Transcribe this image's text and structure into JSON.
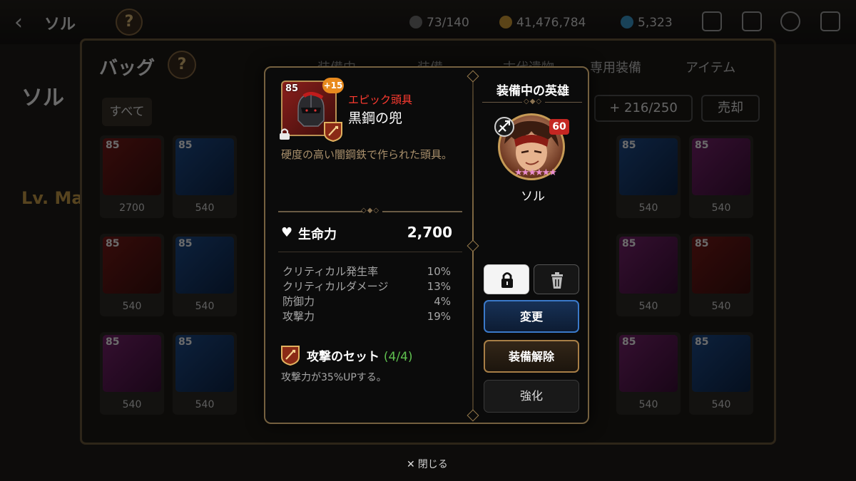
{
  "topbar": {
    "back_label": "‹",
    "title": "ソル",
    "help_label": "?",
    "stamina": "73/140",
    "gold": "41,476,784",
    "crystals": "5,323"
  },
  "bag": {
    "title": "バッグ",
    "help_label": "?",
    "tabs": [
      "装備中",
      "装備",
      "古代遺物",
      "専用装備",
      "アイテム"
    ],
    "filter_all": "すべて",
    "slot_count": "+ 216/250",
    "sell_label": "売却",
    "side_hero": "ソル",
    "side_level": "Lv. Ma",
    "grid": [
      {
        "lvl": "85",
        "val": "2700",
        "color": "red"
      },
      {
        "lvl": "85",
        "val": "540",
        "color": "blue"
      },
      {
        "lvl": "85",
        "val": "540",
        "color": "red"
      },
      {
        "lvl": "85",
        "val": "540",
        "color": "blue"
      },
      {
        "lvl": "85",
        "val": "540",
        "color": "purple"
      },
      {
        "lvl": "85",
        "val": "540",
        "color": "purple"
      },
      {
        "lvl": "85",
        "val": "540",
        "color": "purple"
      },
      {
        "lvl": "85",
        "val": "540",
        "color": "blue"
      },
      {
        "lvl": "85",
        "val": "540",
        "color": "purple"
      },
      {
        "lvl": "85",
        "val": "540",
        "color": "purple"
      },
      {
        "lvl": "85",
        "val": "540",
        "color": "purple"
      },
      {
        "lvl": "85",
        "val": "540",
        "color": "blue"
      }
    ]
  },
  "close_label": "閉じる",
  "item": {
    "level": "85",
    "enhance": "+15",
    "grade": "エピック頭具",
    "name": "黒鋼の兜",
    "description": "硬度の高い闇鋼鉄で作られた頭具。",
    "main_stat": {
      "label": "生命力",
      "value": "2,700"
    },
    "sub_stats": [
      {
        "label": "クリティカル発生率",
        "value": "10%"
      },
      {
        "label": "クリティカルダメージ",
        "value": "13%"
      },
      {
        "label": "防御力",
        "value": "4%"
      },
      {
        "label": "攻撃力",
        "value": "19%"
      }
    ],
    "set": {
      "name": "攻撃のセット",
      "count": "(4/4)",
      "description": "攻撃力が35%UPする。"
    }
  },
  "equipped": {
    "title": "装備中の英雄",
    "hero_name": "ソル",
    "hero_level": "60",
    "stars": "★★★★★★"
  },
  "actions": {
    "change": "変更",
    "unequip": "装備解除",
    "enhance": "強化"
  },
  "colors": {
    "grade_epic": "#ff3b30",
    "set_count": "#5fc04f",
    "change_border": "#3a79c9",
    "unequip_border": "#a77e46"
  }
}
